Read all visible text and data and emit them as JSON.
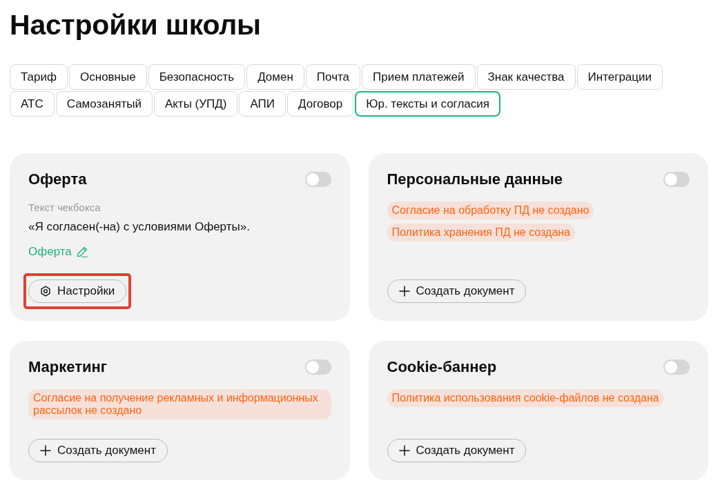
{
  "page_title": "Настройки школы",
  "tab_rows": [
    [
      {
        "label": "Тариф",
        "selected": false
      },
      {
        "label": "Основные",
        "selected": false
      },
      {
        "label": "Безопасность",
        "selected": false
      },
      {
        "label": "Домен",
        "selected": false
      },
      {
        "label": "Почта",
        "selected": false
      },
      {
        "label": "Прием платежей",
        "selected": false
      },
      {
        "label": "Знак качества",
        "selected": false
      },
      {
        "label": "Интеграции",
        "selected": false
      }
    ],
    [
      {
        "label": "АТС",
        "selected": false
      },
      {
        "label": "Самозанятый",
        "selected": false
      },
      {
        "label": "Акты (УПД)",
        "selected": false
      },
      {
        "label": "АПИ",
        "selected": false
      },
      {
        "label": "Договор",
        "selected": false
      },
      {
        "label": "Юр. тексты и согласия",
        "selected": true
      }
    ]
  ],
  "cards": [
    {
      "title": "Оферта",
      "enabled": false,
      "checkbox_caption": "Текст чекбокса",
      "checkbox_text": "«Я согласен(-на) с условиями Оферты».",
      "document_link": "Оферта",
      "button": {
        "kind": "settings",
        "label": "Настройки",
        "highlighted": true
      }
    },
    {
      "title": "Персональные данные",
      "enabled": false,
      "warnings": [
        "Согласие на обработку ПД не создано",
        "Политика хранения ПД не создана"
      ],
      "button": {
        "kind": "create",
        "label": "Создать документ",
        "highlighted": false
      }
    },
    {
      "title": "Маркетинг",
      "enabled": false,
      "warnings": [
        "Согласие на получение рекламных и информационных рассылок не создано"
      ],
      "button": {
        "kind": "create",
        "label": "Создать документ",
        "highlighted": false
      }
    },
    {
      "title": "Cookie-баннер",
      "enabled": false,
      "warnings": [
        "Политика использования cookie-файлов не создана"
      ],
      "button": {
        "kind": "create",
        "label": "Создать документ",
        "highlighted": false
      }
    }
  ]
}
